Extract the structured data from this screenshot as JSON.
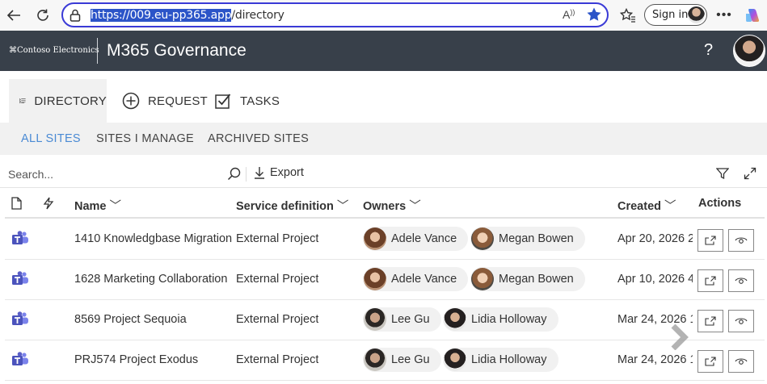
{
  "browser": {
    "url_host": "https://009.eu-pp365.app",
    "url_path": "/directory",
    "signin_label": "Sign in",
    "icons": [
      "back-arrow-icon",
      "refresh-icon",
      "lock-icon",
      "read-aloud-icon",
      "favorite-star-icon",
      "favorites-icon",
      "more-icon",
      "copilot-icon"
    ]
  },
  "header": {
    "logo_text": "⌘Contoso Electronics",
    "title": "M365 Governance",
    "help_label": "?"
  },
  "main_tabs": [
    {
      "label": "DIRECTORY",
      "icon": "list-icon",
      "active": true
    },
    {
      "label": "REQUEST",
      "icon": "plus-circle-icon",
      "active": false
    },
    {
      "label": "TASKS",
      "icon": "checkbox-icon",
      "active": false
    }
  ],
  "sub_tabs": [
    {
      "label": "ALL SITES",
      "active": true
    },
    {
      "label": "SITES I MANAGE",
      "active": false
    },
    {
      "label": "ARCHIVED SITES",
      "active": false
    }
  ],
  "toolbar": {
    "search_placeholder": "Search...",
    "export_label": "Export"
  },
  "table": {
    "columns": {
      "name": "Name",
      "service": "Service definition",
      "owners": "Owners",
      "created": "Created",
      "actions": "Actions"
    },
    "rows": [
      {
        "name": "1410 Knowledgbase Migration",
        "service": "External Project",
        "owners": [
          "Adele Vance",
          "Megan Bowen"
        ],
        "created": "Apr 20, 2026 2"
      },
      {
        "name": "1628 Marketing Collaboration",
        "service": "External Project",
        "owners": [
          "Adele Vance",
          "Megan Bowen"
        ],
        "created": "Apr 10, 2026 4"
      },
      {
        "name": "8569 Project Sequoia",
        "service": "External Project",
        "owners": [
          "Lee Gu",
          "Lidia Holloway"
        ],
        "created": "Mar 24, 2026 1"
      },
      {
        "name": "PRJ574 Project Exodus",
        "service": "External Project",
        "owners": [
          "Lee Gu",
          "Lidia Holloway"
        ],
        "created": "Mar 24, 2026 1"
      }
    ]
  },
  "colors": {
    "header_bg": "#38404a",
    "accent": "#4a8ad4",
    "teams": "#5b5fc7",
    "url_border": "#3a3ad6"
  }
}
